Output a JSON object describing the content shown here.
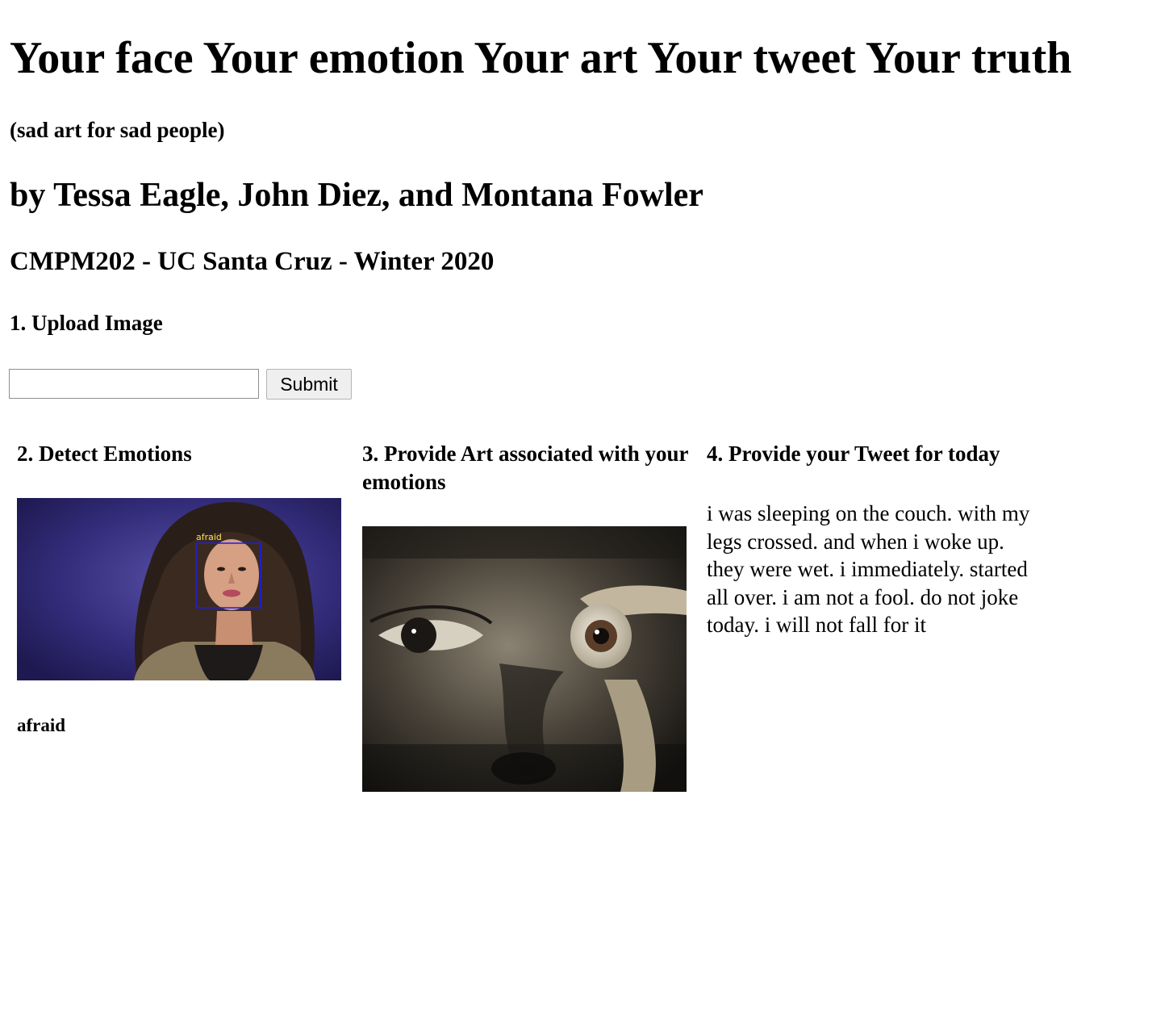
{
  "header": {
    "title": "Your face Your emotion Your art Your tweet Your truth",
    "subtitle": "(sad art for sad people)",
    "authors": "by Tessa Eagle, John Diez, and Montana Fowler",
    "course": "CMPM202 - UC Santa Cruz - Winter 2020"
  },
  "upload": {
    "heading": "1. Upload Image",
    "input_value": "",
    "submit_label": "Submit"
  },
  "detect": {
    "heading": "2. Detect Emotions",
    "face_box_label": "afraid",
    "emotion": "afraid"
  },
  "art": {
    "heading": "3. Provide Art associated with your emotions"
  },
  "tweet": {
    "heading": "4. Provide your Tweet for today",
    "text": "i was sleeping on the couch. with my legs crossed. and when i woke up. they were wet. i immediately. started all over. i am not a fool. do not joke today. i will not fall for it"
  },
  "colors": {
    "face_background": "#2a2466",
    "face_box": "#1a1aff",
    "face_box_label": "#f2e34a"
  }
}
